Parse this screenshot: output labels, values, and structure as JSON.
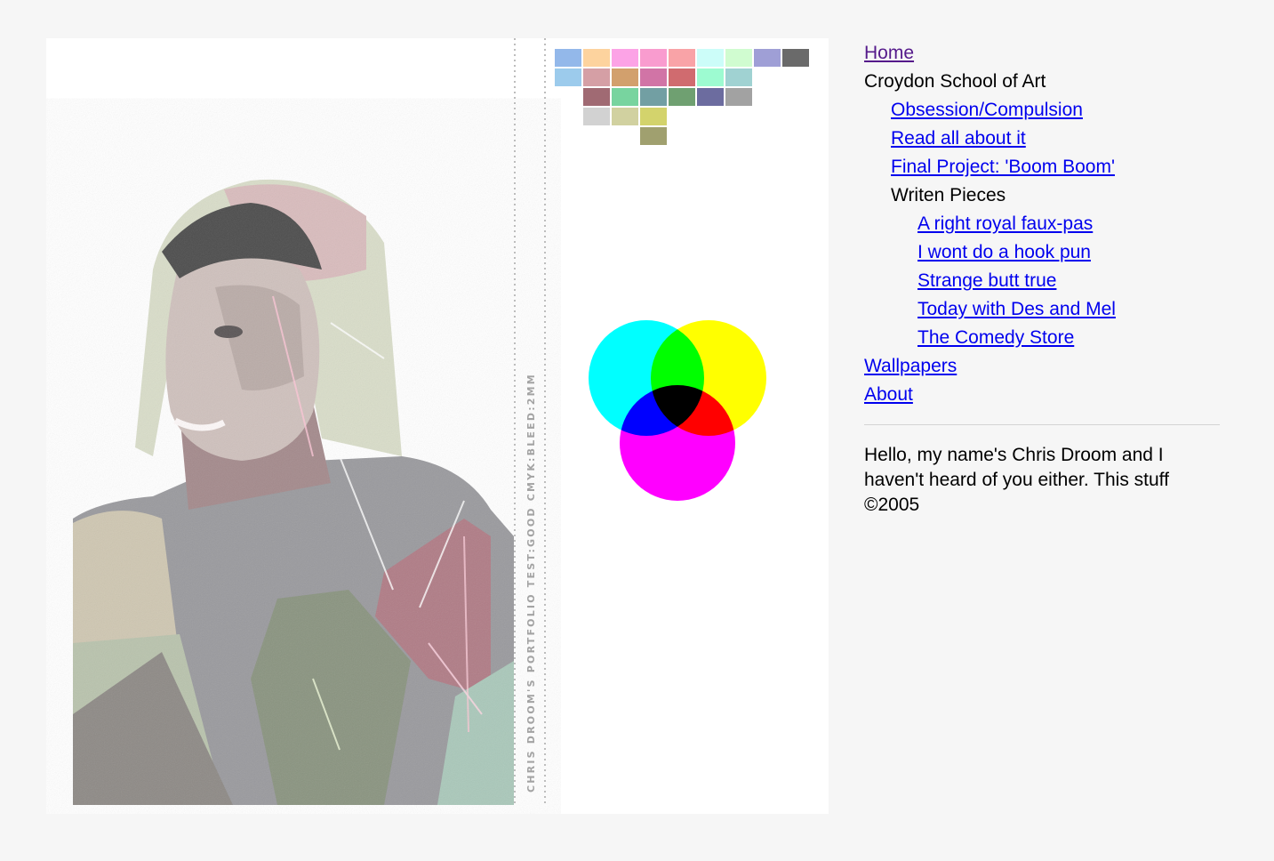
{
  "artwork": {
    "vertical_caption": "CHRIS DROOM'S PORTFOLIO TEST:GOOD CMYK:BLEED:2MM",
    "swatch_colors": [
      [
        "#93b8ea",
        "#fdd39e",
        "#fca3e6",
        "#f99ccf",
        "#f9a3a7",
        "#ccfdf9",
        "#d0fcd0",
        "#9f9fd6",
        "#6a6a6a"
      ],
      [
        "#9ccbec",
        "#d59fa5",
        "#d2a06d",
        "#d174a6",
        "#d06b6f",
        "#9dfbd1",
        "#a0d2d2"
      ],
      [
        "#a06a73",
        "#78d49f",
        "#729fa3",
        "#6fa071",
        "#6c6c9f",
        "#a2a2a2"
      ],
      [
        "#d2d2d2",
        "#d1d1a0",
        "#d3d36c"
      ],
      [
        "#a0a06f"
      ]
    ],
    "cmyk_colors": {
      "cyan": "#00ffff",
      "yellow": "#ffff00",
      "magenta": "#ff00ff"
    }
  },
  "nav": {
    "home": "Home",
    "section": "Croydon School of Art",
    "sub_items": [
      "Obsession/Compulsion",
      "Read all about it",
      "Final Project: 'Boom Boom'"
    ],
    "writen_heading": "Writen Pieces",
    "writen_items": [
      "A right royal faux-pas",
      "I wont do a hook pun",
      "Strange butt true",
      "Today with Des and Mel",
      "The Comedy Store"
    ],
    "wallpapers": "Wallpapers",
    "about": "About"
  },
  "bio": {
    "line1": "Hello, my name's Chris Droom and I haven't heard of you either. This stuff",
    "line2": "©2005"
  }
}
